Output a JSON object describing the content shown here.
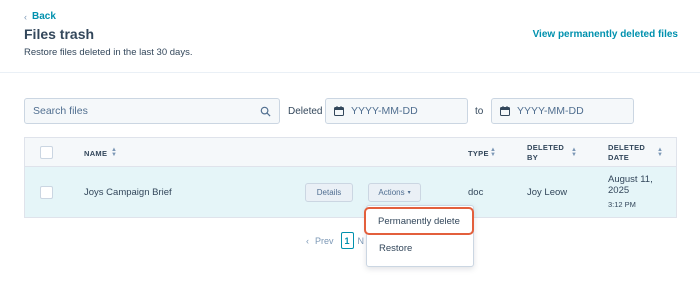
{
  "header": {
    "back_label": "Back",
    "title": "Files trash",
    "subtitle": "Restore files deleted in the last 30 days.",
    "view_deleted_link": "View permanently deleted files"
  },
  "filters": {
    "search_placeholder": "Search files",
    "deleted_label": "Deleted",
    "date_from_placeholder": "YYYY-MM-DD",
    "to_label": "to",
    "date_to_placeholder": "YYYY-MM-DD"
  },
  "table": {
    "columns": {
      "name": "NAME",
      "type": "TYPE",
      "deleted_by_1": "DELETED",
      "deleted_by_2": "BY",
      "deleted_date_1": "DELETED",
      "deleted_date_2": "DATE"
    },
    "rows": [
      {
        "name": "Joys Campaign Brief",
        "details_label": "Details",
        "actions_label": "Actions",
        "type": "doc",
        "deleted_by": "Joy Leow",
        "date_line1": "August 11,",
        "date_line2": "2025",
        "time": "3:12 PM"
      }
    ]
  },
  "pagination": {
    "prev_label": "Prev",
    "current_page": "1",
    "next_partial": "N"
  },
  "actions_menu": {
    "items": [
      "Permanently delete",
      "Restore"
    ]
  },
  "colors": {
    "link": "#0091ae",
    "row_highlight": "#e5f5f8",
    "callout_border": "#e35f3c"
  }
}
